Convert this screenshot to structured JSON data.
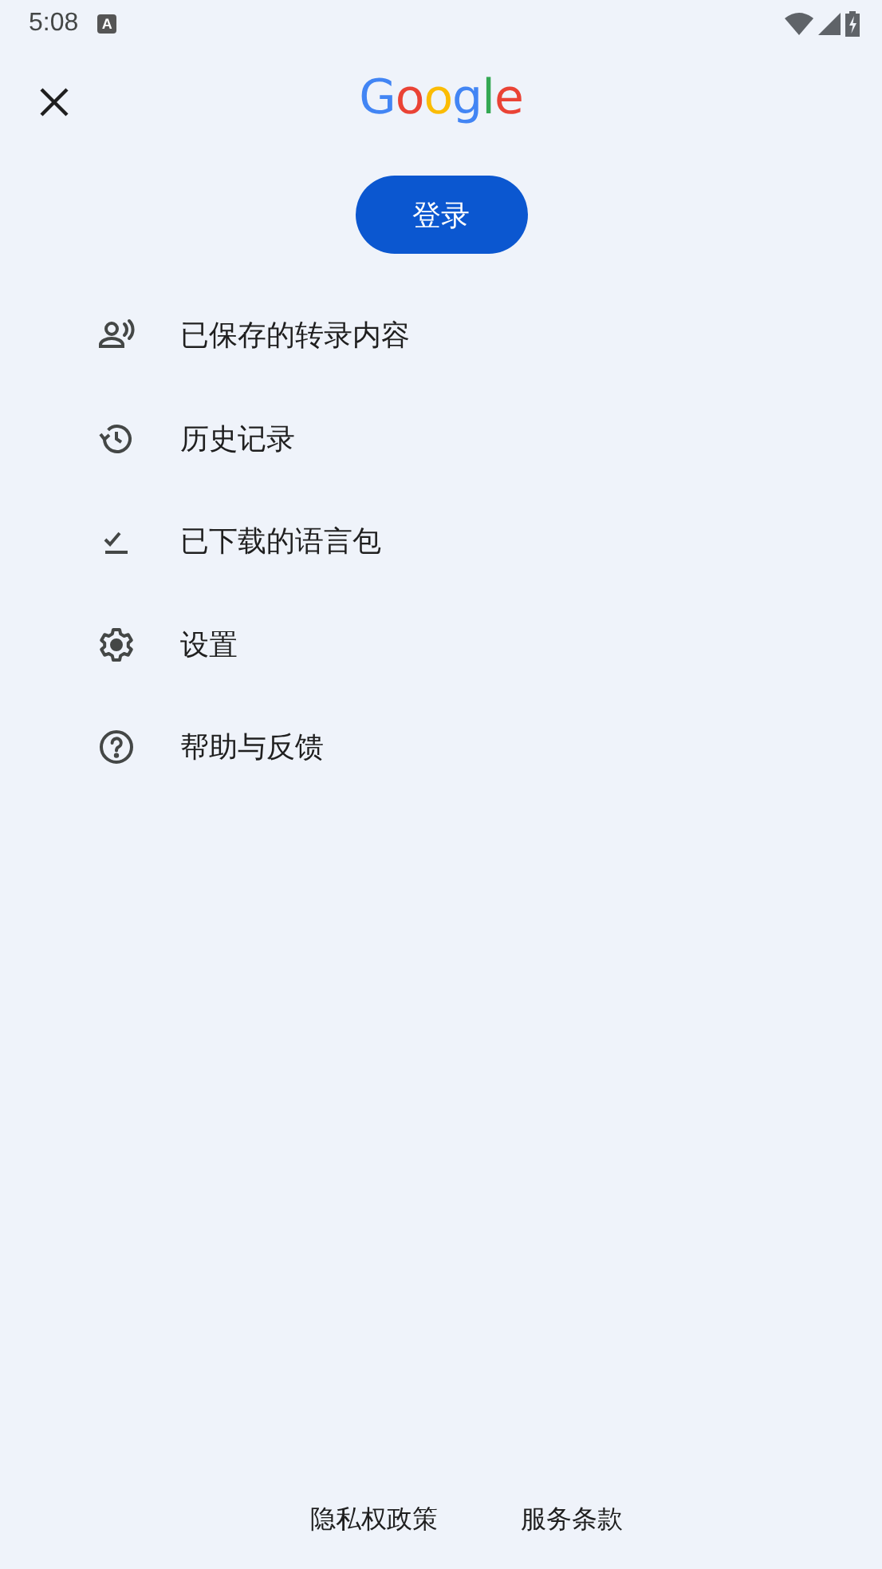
{
  "status_bar": {
    "time": "5:08",
    "notification_icon_label": "A"
  },
  "header": {
    "logo": "Google"
  },
  "sign_in_button": "登录",
  "menu": [
    {
      "kind": "transcripts",
      "label": "已保存的转录内容"
    },
    {
      "kind": "history",
      "label": "历史记录"
    },
    {
      "kind": "downloads",
      "label": "已下载的语言包"
    },
    {
      "kind": "settings",
      "label": "设置"
    },
    {
      "kind": "help",
      "label": "帮助与反馈"
    }
  ],
  "footer_links": [
    "隐私权政策",
    "服务条款"
  ]
}
